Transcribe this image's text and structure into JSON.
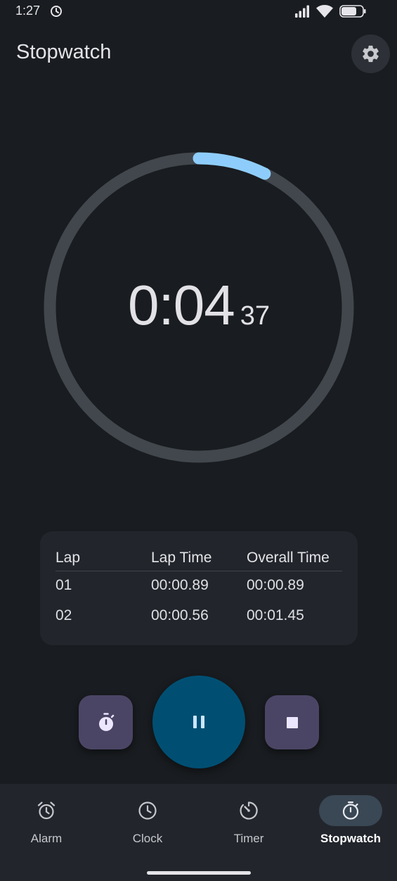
{
  "status_bar": {
    "time": "1:27",
    "icons": [
      "alarm-clock-icon",
      "signal-icon",
      "wifi-icon",
      "battery-icon"
    ]
  },
  "header": {
    "title": "Stopwatch",
    "settings_icon": "gear-icon"
  },
  "stopwatch": {
    "main": "0:04",
    "hundredths": "37",
    "progress_fraction": 0.073
  },
  "laps": {
    "columns": [
      "Lap",
      "Lap Time",
      "Overall Time"
    ],
    "rows": [
      {
        "lap": "01",
        "lap_time": "00:00.89",
        "overall_time": "00:00.89"
      },
      {
        "lap": "02",
        "lap_time": "00:00.56",
        "overall_time": "00:01.45"
      }
    ]
  },
  "controls": {
    "lap_icon": "stopwatch-icon",
    "pause_icon": "pause-icon",
    "stop_icon": "stop-icon"
  },
  "nav": {
    "items": [
      {
        "label": "Alarm",
        "icon": "alarm-icon",
        "active": false
      },
      {
        "label": "Clock",
        "icon": "clock-icon",
        "active": false
      },
      {
        "label": "Timer",
        "icon": "timer-icon",
        "active": false
      },
      {
        "label": "Stopwatch",
        "icon": "stopwatch-icon",
        "active": true
      }
    ]
  },
  "colors": {
    "background": "#191c20",
    "surface": "#22262c",
    "accent": "#8ecdfb",
    "track": "#41474d",
    "primary_container": "#004f73",
    "tertiary_container": "#4b4565",
    "nav_active_pill": "#3a4754"
  }
}
